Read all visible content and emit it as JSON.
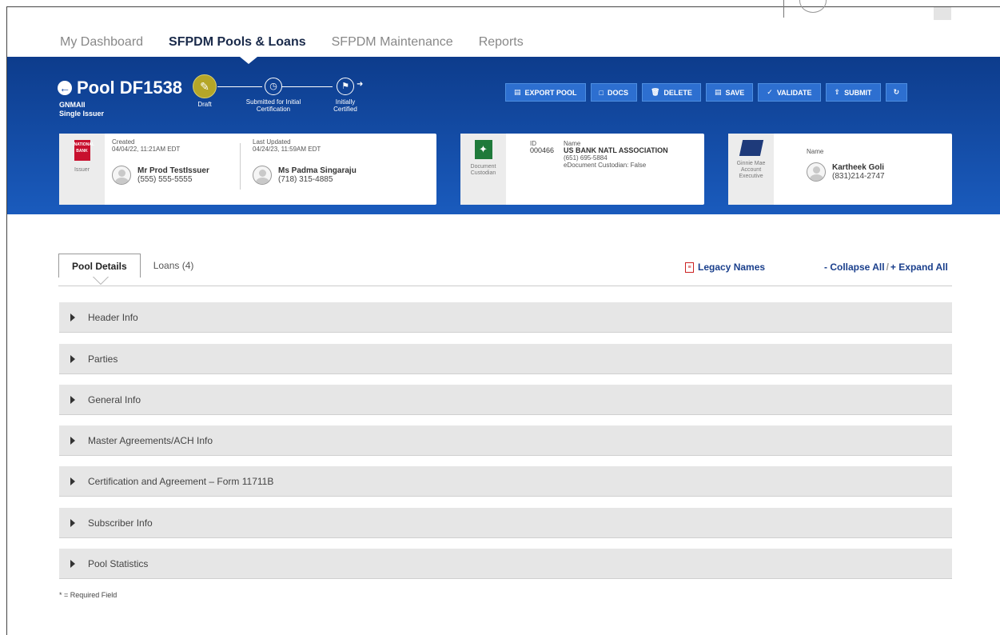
{
  "nav": {
    "items": [
      "My Dashboard",
      "SFPDM Pools & Loans",
      "SFPDM Maintenance",
      "Reports"
    ]
  },
  "pool": {
    "title": "Pool DF1538",
    "type": "GNMAII",
    "issuer_type": "Single Issuer"
  },
  "workflow": {
    "steps": [
      "Draft",
      "Submitted for Initial Certification",
      "Initially Certified"
    ]
  },
  "actions": {
    "export": "EXPORT POOL",
    "docs": "DOCS",
    "delete": "DELETE",
    "save": "SAVE",
    "validate": "VALIDATE",
    "submit": "SUBMIT"
  },
  "issuer_card": {
    "logo_text": "NATIONAL BANK",
    "side_label": "Issuer",
    "created_label": "Created",
    "created_value": "04/04/22, 11:21AM EDT",
    "created_name": "Mr Prod TestIssuer",
    "created_phone": "(555) 555-5555",
    "updated_label": "Last Updated",
    "updated_value": "04/24/23, 11:59AM EDT",
    "updated_name": "Ms Padma Singaraju",
    "updated_phone": "(718) 315-4885"
  },
  "custodian_card": {
    "side_label": "Document Custodian",
    "id_label": "ID",
    "id_value": "000466",
    "name_label": "Name",
    "name_value": "US BANK NATL ASSOCIATION",
    "phone": "(651) 695-5884",
    "edoc": "eDocument Custodian: False"
  },
  "ae_card": {
    "side_label": "Ginnie Mae Account Executive",
    "name_label": "Name",
    "name_value": "Kartheek Goli",
    "phone": "(831)214-2747"
  },
  "tabs": [
    "Pool Details",
    "Loans (4)"
  ],
  "links": {
    "legacy": "Legacy Names",
    "collapse": "- Collapse All",
    "expand": "+ Expand All",
    "separator": "/"
  },
  "sections": [
    "Header Info",
    "Parties",
    "General Info",
    "Master Agreements/ACH Info",
    "Certification and Agreement – Form 11711B",
    "Subscriber Info",
    "Pool Statistics"
  ],
  "footer": {
    "required_note": "* = Required Field"
  }
}
